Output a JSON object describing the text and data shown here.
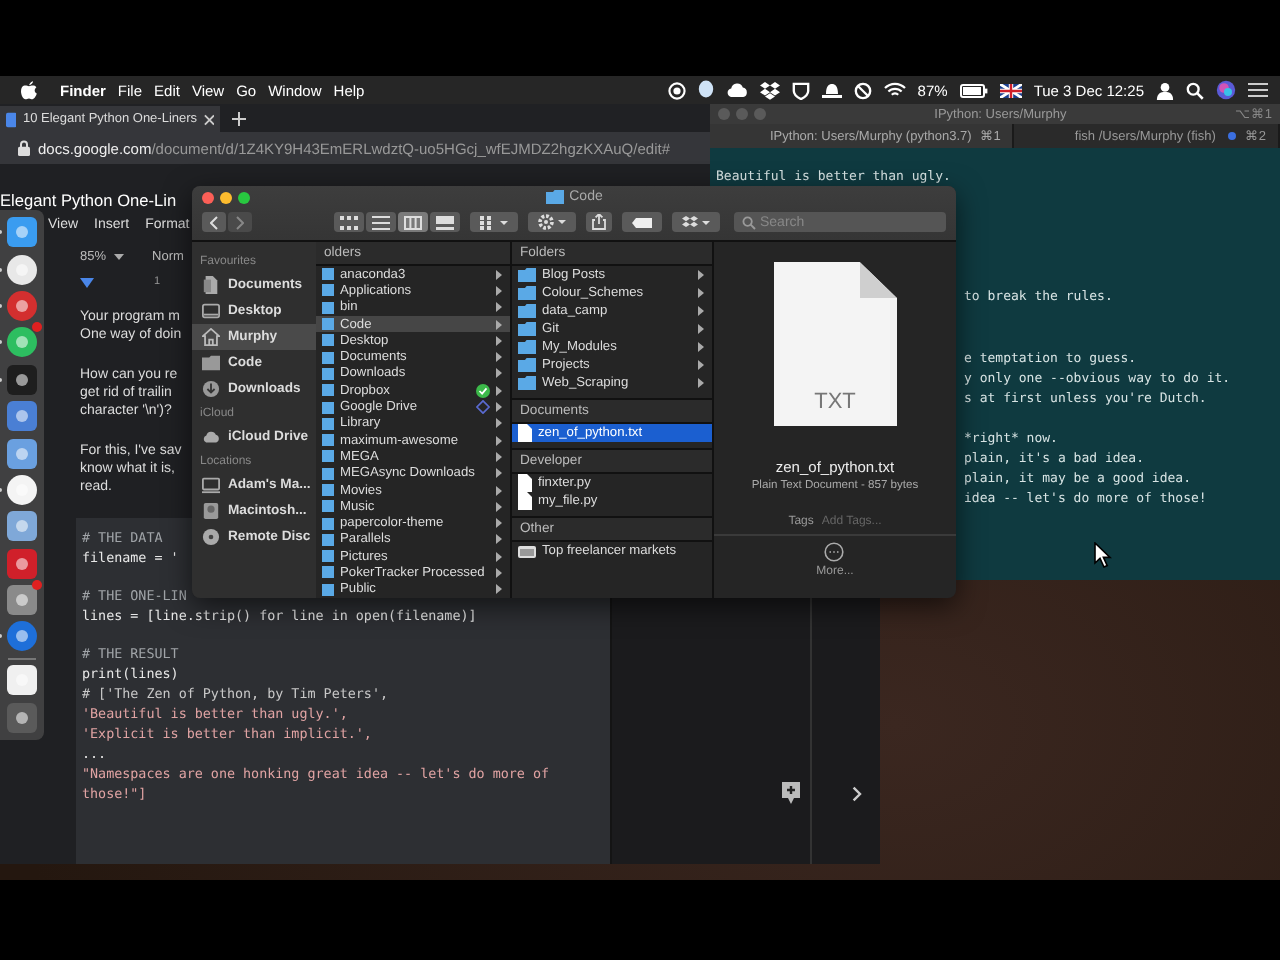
{
  "menu_bar": {
    "app": "Finder",
    "menus": [
      "File",
      "Edit",
      "View",
      "Go",
      "Window",
      "Help"
    ],
    "battery": "87%",
    "clock": "Tue 3 Dec 12:25"
  },
  "browser": {
    "tab": {
      "title": "10 Elegant Python One-Liners",
      "selected": true
    },
    "url_host": "docs.google.com",
    "url_path": "/document/d/1Z4KY9H43EmERLwdztQ-uo5HGcj_wfEJMDZ2hgzKXAuQ/edit#",
    "doc_title": "Elegant Python One-Lin",
    "doc_menus": [
      "View",
      "Insert",
      "Format"
    ],
    "zoom": "85%",
    "style": "Norm",
    "ruler_mark": "1",
    "paragraphs": [
      [
        "Your program m",
        "One way of doin"
      ],
      [
        "How can you re",
        "get rid of trailin",
        "character '\\n')?"
      ],
      [
        "For this, I've sav",
        "know what it is,",
        "read."
      ]
    ],
    "code_lines": [
      {
        "text": "# THE DATA",
        "kind": "comment"
      },
      {
        "text": "filename = '",
        "kind": "code"
      },
      {
        "text": "# THE ONE-LIN",
        "kind": "comment"
      },
      {
        "text": "lines = [line.strip() for line in open(filename)]",
        "kind": "code"
      },
      {
        "text": "# THE RESULT",
        "kind": "comment"
      },
      {
        "text": "print(lines)",
        "kind": "code"
      },
      {
        "text": "# ['The Zen of Python, by Tim Peters',",
        "kind": "result"
      },
      {
        "text": "'Beautiful is better than ugly.',",
        "kind": "string"
      },
      {
        "text": "'Explicit is better than implicit.',",
        "kind": "string"
      },
      {
        "text": "...",
        "kind": "code"
      },
      {
        "text": "\"Namespaces are one honking great idea -- let's do more of",
        "kind": "string"
      },
      {
        "text": "those!\"]",
        "kind": "string"
      }
    ]
  },
  "dock": {
    "apps": [
      {
        "kind": "face",
        "running": true,
        "badge": false
      },
      {
        "kind": "browser",
        "running": true,
        "badge": false
      },
      {
        "kind": "vpn",
        "running": true,
        "badge": false
      },
      {
        "kind": "elephant",
        "running": true,
        "badge": true
      },
      {
        "kind": "terminal",
        "running": true,
        "badge": false
      },
      {
        "kind": "hammer",
        "running": false,
        "badge": false
      },
      {
        "kind": "photo",
        "running": false,
        "badge": false
      },
      {
        "kind": "chat",
        "running": true,
        "badge": false
      },
      {
        "kind": "cards",
        "running": false,
        "badge": false
      },
      {
        "kind": "shield",
        "running": false,
        "badge": false
      },
      {
        "kind": "gear",
        "running": false,
        "badge": true
      },
      {
        "kind": "ring",
        "running": true,
        "badge": false
      },
      {
        "kind": "document",
        "running": false,
        "badge": false
      },
      {
        "kind": "trash",
        "running": false,
        "badge": false
      }
    ]
  },
  "terminal": {
    "title": "IPython: Users/Murphy",
    "shortcut": "⌥⌘1",
    "tabs": [
      {
        "label": "IPython: Users/Murphy (python3.7)",
        "shortcut": "⌘1",
        "selected": true,
        "activity": false
      },
      {
        "label": "fish /Users/Murphy (fish)",
        "shortcut": "⌘2",
        "selected": false,
        "activity": true
      }
    ],
    "output_blocks": [
      [
        "Beautiful is better than ugly."
      ],
      [
        "to break the rules."
      ],
      [
        "e temptation to guess.",
        "y only one --obvious way to do it.",
        "s at first unless you're Dutch."
      ],
      [
        "*right* now.",
        "plain, it's a bad idea.",
        "plain, it may be a good idea.",
        "idea -- let's do more of those!"
      ]
    ]
  },
  "finder": {
    "title": "Code",
    "search_placeholder": "Search",
    "view_modes": [
      {
        "selected": false
      },
      {
        "selected": false
      },
      {
        "selected": true
      },
      {
        "selected": false
      }
    ],
    "sidebar": [
      {
        "heading": "Favourites",
        "items": [
          {
            "label": "Documents",
            "kind": "document",
            "selected": false
          },
          {
            "label": "Desktop",
            "kind": "desktop",
            "selected": false
          },
          {
            "label": "Murphy",
            "kind": "home",
            "selected": true
          },
          {
            "label": "Code",
            "kind": "folder",
            "selected": false
          },
          {
            "label": "Downloads",
            "kind": "download",
            "selected": false
          }
        ]
      },
      {
        "heading": "iCloud",
        "items": [
          {
            "label": "iCloud Drive",
            "kind": "cloud",
            "selected": false
          }
        ]
      },
      {
        "heading": "Locations",
        "items": [
          {
            "label": "Adam's Ma...",
            "kind": "computer",
            "selected": false
          },
          {
            "label": "Macintosh...",
            "kind": "drive",
            "selected": false
          },
          {
            "label": "Remote Disc",
            "kind": "disc",
            "selected": false
          }
        ]
      }
    ],
    "column_1": {
      "heading": "olders",
      "items": [
        {
          "label": "anaconda3",
          "kind": "folder",
          "selected": false
        },
        {
          "label": "Applications",
          "kind": "folder",
          "selected": false
        },
        {
          "label": "bin",
          "kind": "folder",
          "selected": false
        },
        {
          "label": "Code",
          "kind": "folder",
          "selected": true
        },
        {
          "label": "Desktop",
          "kind": "folder",
          "selected": false
        },
        {
          "label": "Documents",
          "kind": "folder",
          "selected": false
        },
        {
          "label": "Downloads",
          "kind": "folder",
          "selected": false
        },
        {
          "label": "Dropbox",
          "kind": "synced",
          "selected": false
        },
        {
          "label": "Google Drive",
          "kind": "syncing",
          "selected": false
        },
        {
          "label": "Library",
          "kind": "folder",
          "selected": false
        },
        {
          "label": "maximum-awesome",
          "kind": "folder",
          "selected": false
        },
        {
          "label": "MEGA",
          "kind": "folder",
          "selected": false
        },
        {
          "label": "MEGAsync Downloads",
          "kind": "folder",
          "selected": false
        },
        {
          "label": "Movies",
          "kind": "folder",
          "selected": false
        },
        {
          "label": "Music",
          "kind": "folder",
          "selected": false
        },
        {
          "label": "papercolor-theme",
          "kind": "folder",
          "selected": false
        },
        {
          "label": "Parallels",
          "kind": "folder",
          "selected": false
        },
        {
          "label": "Pictures",
          "kind": "folder",
          "selected": false
        },
        {
          "label": "PokerTracker Processed",
          "kind": "folder",
          "selected": false
        },
        {
          "label": "Public",
          "kind": "folder",
          "selected": false
        }
      ]
    },
    "column_2": [
      {
        "heading": "Folders",
        "items": [
          {
            "label": "Blog Posts",
            "kind": "folder",
            "selected": false
          },
          {
            "label": "Colour_Schemes",
            "kind": "folder",
            "selected": false
          },
          {
            "label": "data_camp",
            "kind": "folder",
            "selected": false
          },
          {
            "label": "Git",
            "kind": "folder",
            "selected": false
          },
          {
            "label": "My_Modules",
            "kind": "folder",
            "selected": false
          },
          {
            "label": "Projects",
            "kind": "folder",
            "selected": false
          },
          {
            "label": "Web_Scraping",
            "kind": "folder",
            "selected": false
          }
        ]
      },
      {
        "heading": "Documents",
        "items": [
          {
            "label": "zen_of_python.txt",
            "kind": "file",
            "selected": true
          }
        ]
      },
      {
        "heading": "Developer",
        "items": [
          {
            "label": "finxter.py",
            "kind": "file",
            "selected": false
          },
          {
            "label": "my_file.py",
            "kind": "file",
            "selected": false
          }
        ]
      },
      {
        "heading": "Other",
        "items": [
          {
            "label": "Top freelancer markets",
            "kind": "link",
            "selected": false
          }
        ]
      }
    ],
    "preview": {
      "file_type": "TXT",
      "name": "zen_of_python.txt",
      "info": "Plain Text Document - 857 bytes",
      "tags_label": "Tags",
      "tags_placeholder": "Add Tags...",
      "more": "More..."
    }
  }
}
